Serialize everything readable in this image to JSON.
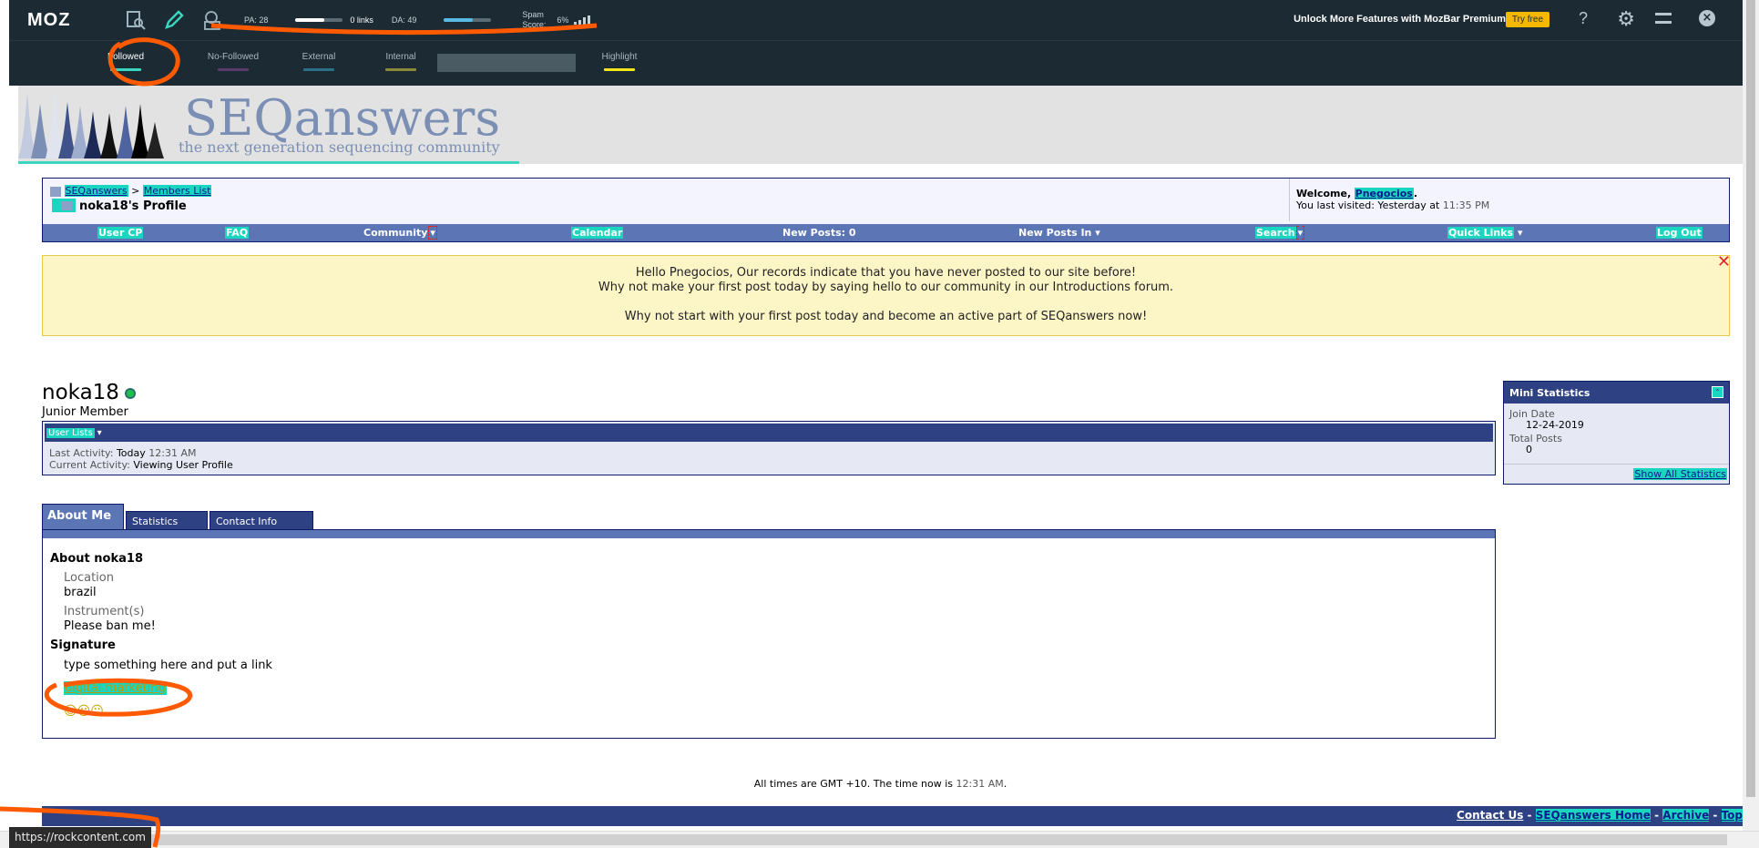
{
  "mozbar": {
    "logo": "MOZ",
    "pa": "PA: 28",
    "links": "0 links",
    "da": "DA: 49",
    "spam_label": "Spam Score:",
    "spam_value": "6%",
    "premium": "Unlock More Features with MozBar Premium",
    "try": "Try free",
    "help": "?",
    "highlight_tabs": [
      "Followed",
      "No-Followed",
      "External",
      "Internal",
      "Highlight"
    ],
    "highlight_colors": [
      "#3ad6c1",
      "#5a3a6a",
      "#2d6f86",
      "#8a8a3a",
      "#f5e51a"
    ]
  },
  "site": {
    "title": "SEQanswers",
    "subtitle": "the next generation sequencing community"
  },
  "nav": {
    "crumb_1": "SEQanswers",
    "crumb_sep": ">",
    "crumb_2": "Members List",
    "page_title": "noka18's Profile",
    "welcome_label": "Welcome,",
    "welcome_user": "Pnegocios",
    "visited": "You last visited: Yesterday at",
    "visited_time": "11:35 PM",
    "items": [
      "User CP",
      "FAQ",
      "Community",
      "Calendar",
      "New Posts: 0",
      "New Posts In",
      "Search",
      "Quick Links",
      "Log Out"
    ]
  },
  "notice": {
    "line1": "Hello Pnegocios, Our records indicate that you have never posted to our site before!",
    "line2": "Why not make your first post today by saying hello to our community in our Introductions forum.",
    "line3": "Why not start with your first post today and become an active part of SEQanswers now!"
  },
  "profile": {
    "username": "noka18",
    "rank": "Junior Member",
    "user_lists": "User Lists",
    "last_activity_label": "Last Activity:",
    "last_activity": "Today",
    "last_activity_time": "12:31 AM",
    "current_activity_label": "Current Activity:",
    "current_activity": "Viewing User Profile"
  },
  "mini_stats": {
    "title": "Mini Statistics",
    "join_label": "Join Date",
    "join_value": "12-24-2019",
    "posts_label": "Total Posts",
    "posts_value": "0",
    "show_all": "Show All Statistics"
  },
  "tabs": [
    "About Me",
    "Statistics",
    "Contact Info"
  ],
  "about": {
    "heading": "About noka18",
    "location_label": "Location",
    "location": "brazil",
    "instrument_label": "Instrument(s)",
    "instrument": "Please ban me!",
    "signature_heading": "Signature",
    "signature_text": "type something here and put a link",
    "signature_link": "digital marketing",
    "smileys": "☺☺☺"
  },
  "footer": {
    "times": "All times are GMT +10. The time now is",
    "time_now": "12:31 AM",
    "period": ".",
    "links": [
      "Contact Us",
      "SEQanswers Home",
      "Archive",
      "Top"
    ]
  },
  "status_url": "https://rockcontent.com"
}
